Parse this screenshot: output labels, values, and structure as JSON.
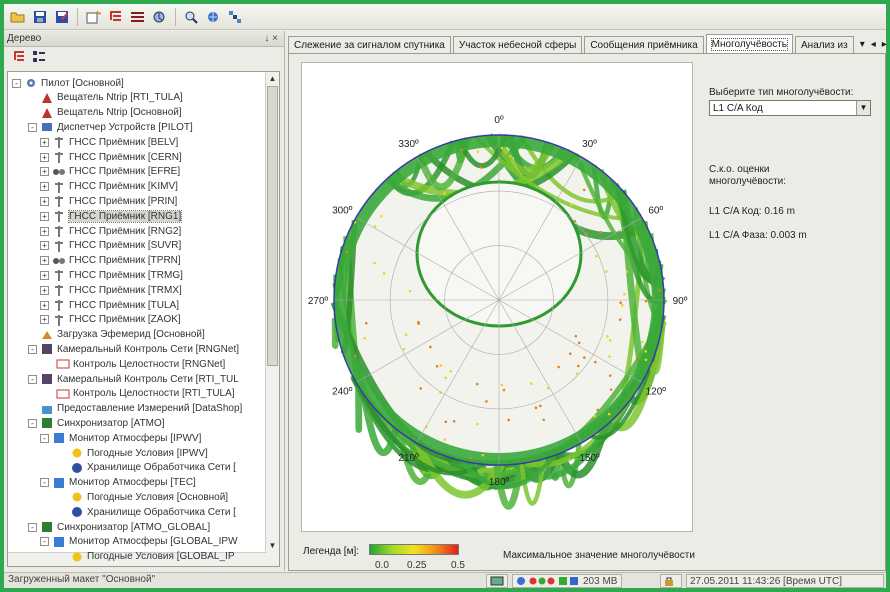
{
  "tree_panel": {
    "title": "Дерево",
    "pin_label": "↓ ×",
    "items": [
      {
        "label": "Пилот [Основной]",
        "icon": "settings-gear-icon",
        "expander": "-"
      },
      {
        "label": "Вещатель Ntrip [RTI_TULA]",
        "icon": "broadcaster-icon",
        "expander": ""
      },
      {
        "label": "Вещатель Ntrip [Основной]",
        "icon": "broadcaster-icon",
        "expander": ""
      },
      {
        "label": "Диспетчер Устройств [PILOT]",
        "icon": "device-manager-icon",
        "expander": "-"
      },
      {
        "label": "ГНСС Приёмник [BELV]",
        "icon": "antenna-icon",
        "expander": "+"
      },
      {
        "label": "ГНСС Приёмник [CERN]",
        "icon": "antenna-icon",
        "expander": "+"
      },
      {
        "label": "ГНСС Приёмник [EFRE]",
        "icon": "receiver-link-icon",
        "expander": "+"
      },
      {
        "label": "ГНСС Приёмник [KIMV]",
        "icon": "antenna-icon",
        "expander": "+"
      },
      {
        "label": "ГНСС Приёмник [PRIN]",
        "icon": "antenna-icon",
        "expander": "+"
      },
      {
        "label": "ГНСС Приёмник [RNG1]",
        "icon": "antenna-icon",
        "expander": "+"
      },
      {
        "label": "ГНСС Приёмник [RNG2]",
        "icon": "antenna-icon",
        "expander": "+"
      },
      {
        "label": "ГНСС Приёмник [SUVR]",
        "icon": "antenna-icon",
        "expander": "+"
      },
      {
        "label": "ГНСС Приёмник [TPRN]",
        "icon": "receiver-link-icon",
        "expander": "+"
      },
      {
        "label": "ГНСС Приёмник [TRMG]",
        "icon": "antenna-icon",
        "expander": "+"
      },
      {
        "label": "ГНСС Приёмник [TRMX]",
        "icon": "antenna-icon",
        "expander": "+"
      },
      {
        "label": "ГНСС Приёмник [TULA]",
        "icon": "antenna-icon",
        "expander": "+"
      },
      {
        "label": "ГНСС Приёмник [ZAOK]",
        "icon": "antenna-icon",
        "expander": "+"
      },
      {
        "label": "Загрузка Эфемерид [Основной]",
        "icon": "ephemeris-icon",
        "expander": ""
      },
      {
        "label": "Камеральный Контроль Сети [RNGNet]",
        "icon": "network-control-icon",
        "expander": "-"
      },
      {
        "label": "Контроль Целостности [RNGNet]",
        "icon": "integrity-icon",
        "expander": ""
      },
      {
        "label": "Камеральный Контроль Сети [RTI_TUL",
        "icon": "network-control-icon",
        "expander": "-"
      },
      {
        "label": "Контроль Целостности [RTI_TULA]",
        "icon": "integrity-icon",
        "expander": ""
      },
      {
        "label": "Предоставление Измерений [DataShop]",
        "icon": "datashop-icon",
        "expander": ""
      },
      {
        "label": "Синхронизатор [ATMO]",
        "icon": "synchronizer-icon",
        "expander": "-"
      },
      {
        "label": "Монитор Атмосферы [IPWV]",
        "icon": "atmosphere-monitor-icon",
        "expander": "-"
      },
      {
        "label": "Погодные Условия [IPWV]",
        "icon": "weather-icon",
        "expander": ""
      },
      {
        "label": "Хранилище Обработчика Сети [",
        "icon": "storage-icon",
        "expander": ""
      },
      {
        "label": "Монитор Атмосферы [TEC]",
        "icon": "atmosphere-monitor-icon",
        "expander": "-"
      },
      {
        "label": "Погодные Условия [Основной]",
        "icon": "weather-icon",
        "expander": ""
      },
      {
        "label": "Хранилище Обработчика Сети [",
        "icon": "storage-icon",
        "expander": ""
      },
      {
        "label": "Синхронизатор [ATMO_GLOBAL]",
        "icon": "synchronizer-icon",
        "expander": "-"
      },
      {
        "label": "Монитор Атмосферы [GLOBAL_IPW",
        "icon": "atmosphere-monitor-icon",
        "expander": "-"
      },
      {
        "label": "Погодные Условия [GLOBAL_IP",
        "icon": "weather-icon",
        "expander": ""
      }
    ],
    "selected_index": 9
  },
  "tabs": [
    {
      "label": "Слежение за сигналом спутника"
    },
    {
      "label": "Участок небесной сферы"
    },
    {
      "label": "Сообщения приёмника"
    },
    {
      "label": "Многолучёвость"
    },
    {
      "label": "Анализ из"
    }
  ],
  "active_tab": 3,
  "tab_nav": {
    "menu": "▾",
    "prev": "◂",
    "next": "▸"
  },
  "multipath": {
    "select_label": "Выберите тип многолучёвости:",
    "select_value": "L1 C/A Код",
    "rms_title_1": "С.к.о. оценки",
    "rms_title_2": "многолучёвости:",
    "code_rms": "L1 C/A Код: 0.16 m",
    "phase_rms": "L1 C/A Фаза: 0.003 m"
  },
  "legend": {
    "label": "Легенда [м]:",
    "ticks": [
      "0.0",
      "0.25",
      "0.5"
    ],
    "max_label": "Максимальное значение многолучёвости"
  },
  "skyplot": {
    "azimuth_labels": [
      "0º",
      "30º",
      "60º",
      "90º",
      "120º",
      "150º",
      "180º",
      "210º",
      "240º",
      "270º",
      "300º",
      "330º"
    ]
  },
  "statusbar": {
    "message": "Загруженный макет \"Основной\"",
    "memory": "203 MB",
    "datetime": "27.05.2011 11:43:26 [Время UTC]"
  },
  "colors": {
    "window_border": "#2fa84f",
    "track_green": "#2f9a2f",
    "sky_outline": "#3a3aa8"
  }
}
